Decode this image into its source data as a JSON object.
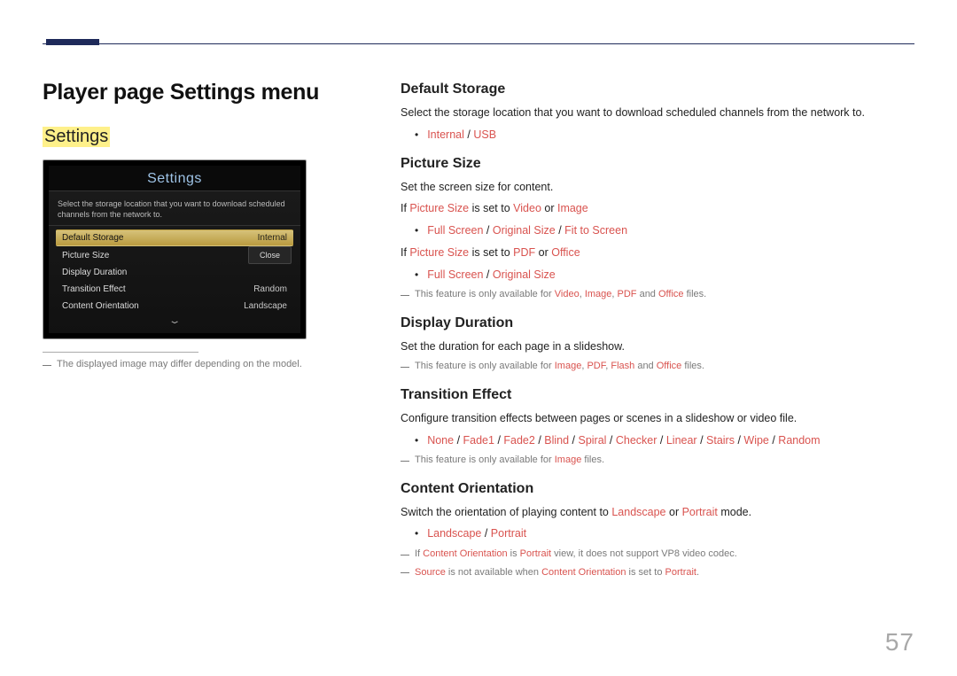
{
  "page_number": "57",
  "page_title": "Player page Settings menu",
  "section_highlight": "Settings",
  "tv": {
    "title": "Settings",
    "desc_line1": "Select the storage location that you want to download scheduled",
    "desc_line2": "channels from the network to.",
    "rows": {
      "r0_label": "Default Storage",
      "r0_value": "Internal",
      "r1_label": "Picture Size",
      "r1_value": "",
      "r2_label": "Display Duration",
      "r2_value": "",
      "r3_label": "Transition Effect",
      "r3_value": "Random",
      "r4_label": "Content Orientation",
      "r4_value": "Landscape"
    },
    "close_button": "Close",
    "caret": "⌄"
  },
  "figure_note": "The displayed image may differ depending on the model.",
  "sections": {
    "default_storage": {
      "title": "Default Storage",
      "desc": "Select the storage location that you want to download scheduled channels from the network to.",
      "opts": {
        "a": "Internal",
        "b": "USB"
      }
    },
    "picture_size": {
      "title": "Picture Size",
      "desc": "Set the screen size for content.",
      "if1_pre": "If ",
      "if1_ps": "Picture Size",
      "if1_mid": " is set to ",
      "if1_v": "Video",
      "if1_or": " or ",
      "if1_i": "Image",
      "opts1": {
        "a": "Full Screen",
        "b": "Original Size",
        "c": "Fit to Screen"
      },
      "if2_pre": "If ",
      "if2_ps": "Picture Size",
      "if2_mid": " is set to ",
      "if2_p": "PDF",
      "if2_or": " or ",
      "if2_o": "Office",
      "opts2": {
        "a": "Full Screen",
        "b": "Original Size"
      },
      "note_pre": "This feature is only available for ",
      "note_v": "Video",
      "note_c1": ", ",
      "note_i": "Image",
      "note_c2": ", ",
      "note_p": "PDF",
      "note_and": " and ",
      "note_o": "Office",
      "note_end": " files."
    },
    "display_duration": {
      "title": "Display Duration",
      "desc": "Set the duration for each page in a slideshow.",
      "note_pre": "This feature is only available for ",
      "note_i": "Image",
      "note_c1": ", ",
      "note_p": "PDF",
      "note_c2": ", ",
      "note_f": "Flash",
      "note_and": " and ",
      "note_o": "Office",
      "note_end": " files."
    },
    "transition_effect": {
      "title": "Transition Effect",
      "desc": "Configure transition effects between pages or scenes in a slideshow or video file.",
      "opts": {
        "a": "None",
        "b": "Fade1",
        "c": "Fade2",
        "d": "Blind",
        "e": "Spiral",
        "f": "Checker",
        "g": "Linear",
        "h": "Stairs",
        "i": "Wipe",
        "j": "Random"
      },
      "note_pre": "This feature is only available for ",
      "note_i": "Image",
      "note_end": " files."
    },
    "content_orientation": {
      "title": "Content Orientation",
      "desc_pre": "Switch the orientation of playing content to ",
      "desc_l": "Landscape",
      "desc_or": " or ",
      "desc_p": "Portrait",
      "desc_end": " mode.",
      "opts": {
        "a": "Landscape",
        "b": "Portrait"
      },
      "n1_pre": "If ",
      "n1_co": "Content Orientation",
      "n1_mid": " is ",
      "n1_p": "Portrait",
      "n1_end": " view, it does not support VP8 video codec.",
      "n2_src": "Source",
      "n2_mid": " is not available when ",
      "n2_co": "Content Orientation",
      "n2_mid2": " is set to ",
      "n2_p": "Portrait",
      "n2_end": "."
    }
  },
  "sl": " / "
}
